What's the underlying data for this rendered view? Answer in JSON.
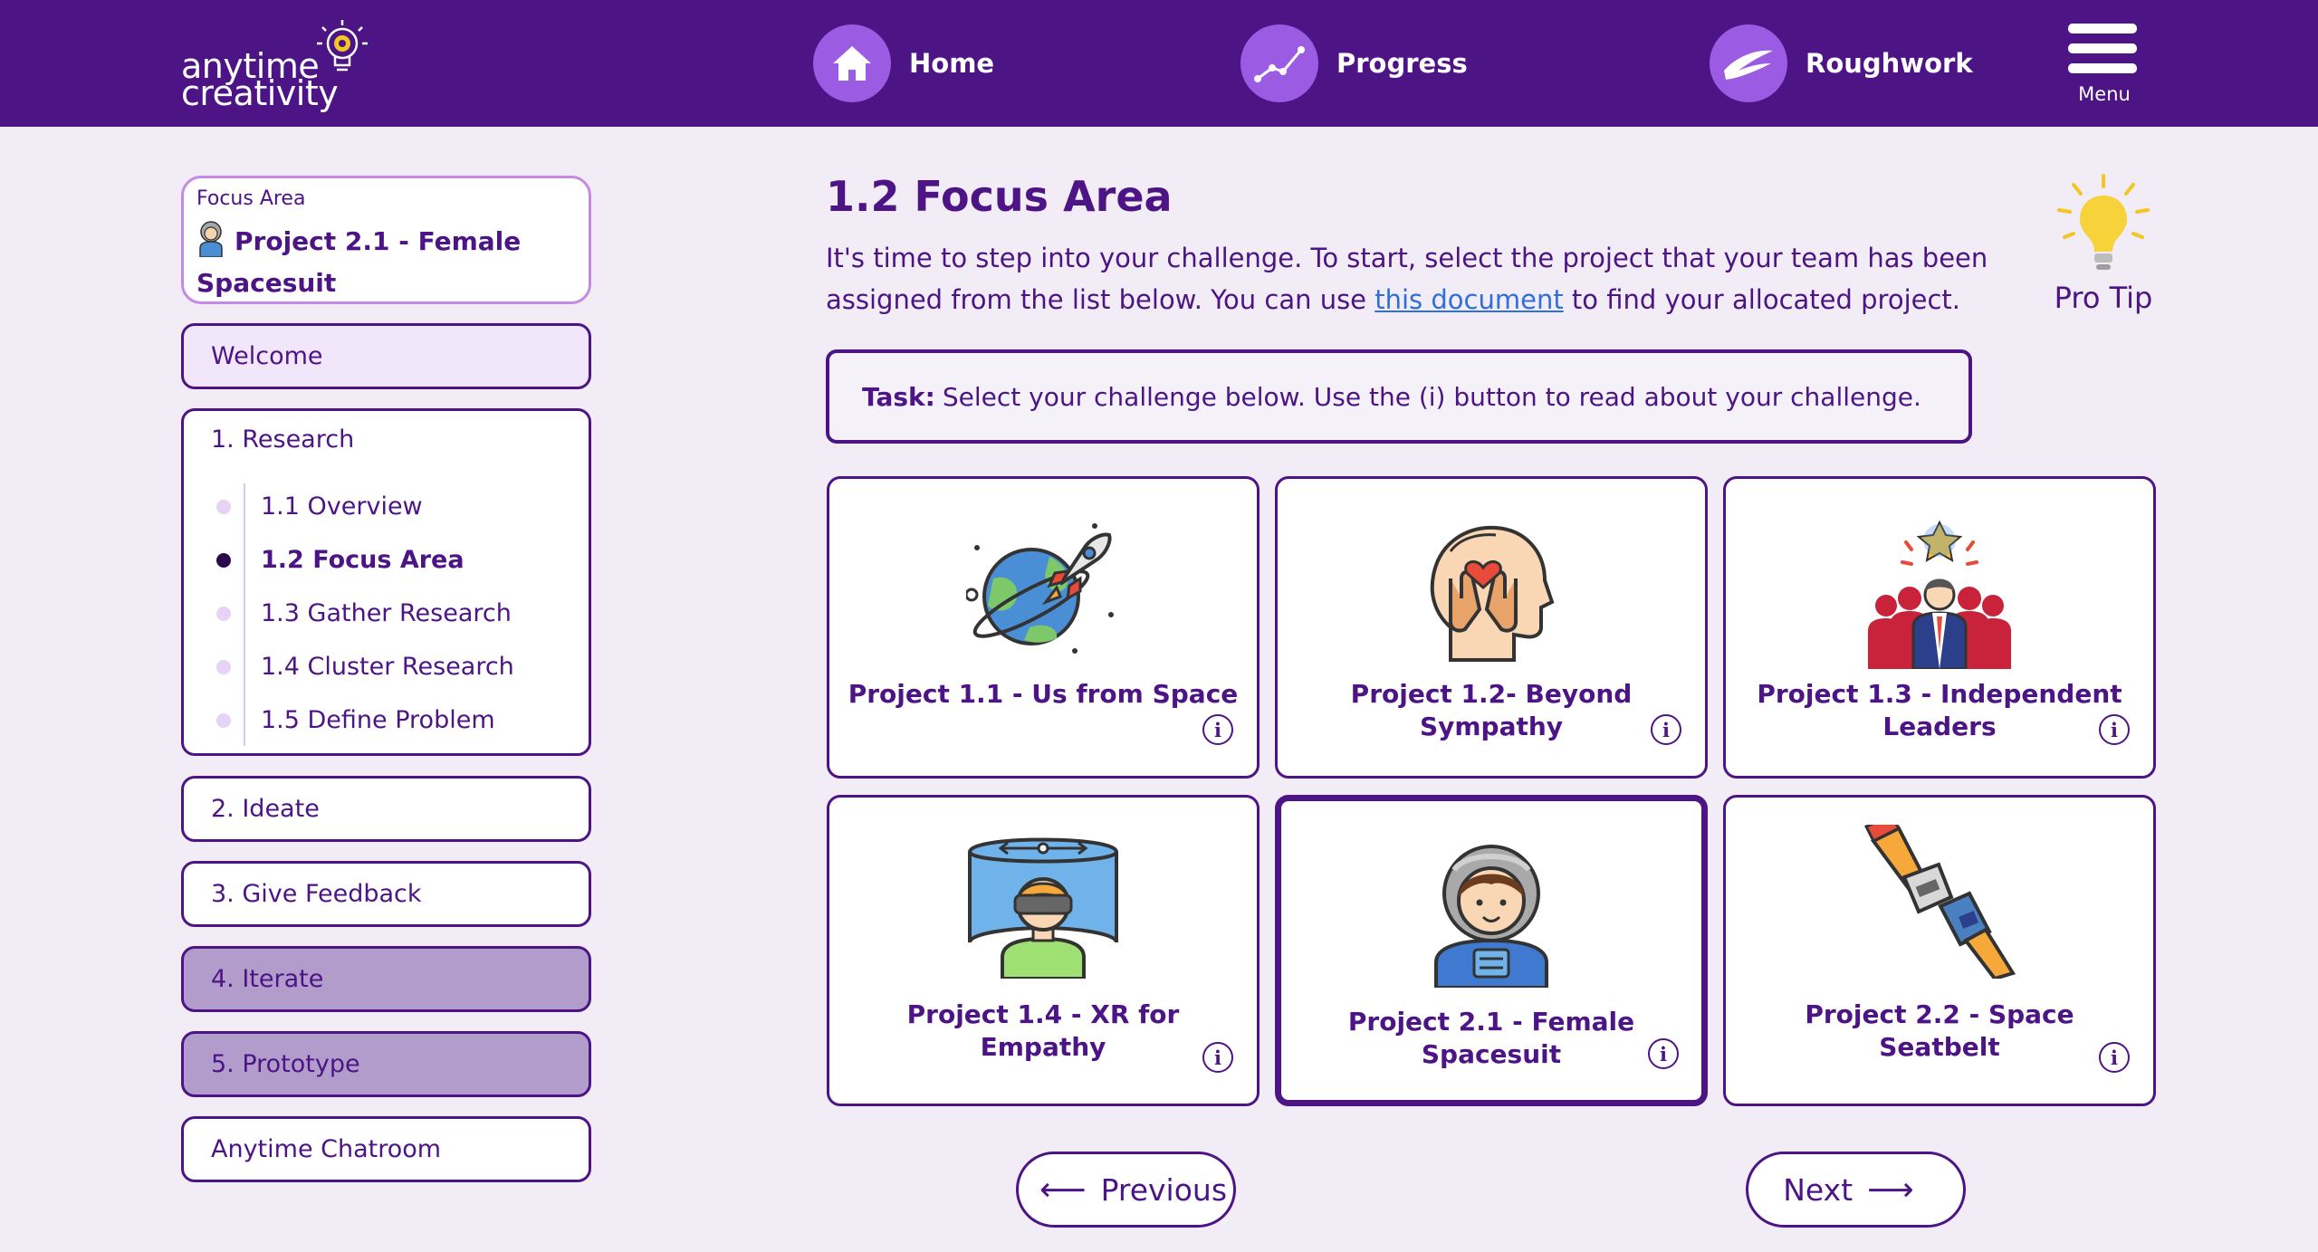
{
  "header": {
    "logo_line1": "anytime",
    "logo_line2": "creativity",
    "nav": [
      {
        "label": "Home",
        "icon": "home-icon"
      },
      {
        "label": "Progress",
        "icon": "progress-chart-icon"
      },
      {
        "label": "Roughwork",
        "icon": "brush-stroke-icon"
      }
    ],
    "menu_label": "Menu"
  },
  "sidebar": {
    "focus_caption": "Focus Area",
    "focus_value": "Project 2.1 - Female Spacesuit",
    "welcome": "Welcome",
    "research": {
      "label": "1. Research",
      "items": [
        {
          "label": "1.1 Overview",
          "active": false
        },
        {
          "label": "1.2 Focus Area",
          "active": true
        },
        {
          "label": "1.3 Gather Research",
          "active": false
        },
        {
          "label": "1.4 Cluster Research",
          "active": false
        },
        {
          "label": "1.5 Define Problem",
          "active": false
        }
      ]
    },
    "sections": [
      {
        "label": "2. Ideate",
        "locked": false
      },
      {
        "label": "3. Give Feedback",
        "locked": false
      },
      {
        "label": "4. Iterate",
        "locked": true
      },
      {
        "label": "5. Prototype",
        "locked": true
      },
      {
        "label": "Anytime Chatroom",
        "locked": false
      }
    ]
  },
  "main": {
    "title": "1.2 Focus Area",
    "intro_before_link": "It's time to step into your challenge. To start, select the project that your team has been assigned from the list below. You can use ",
    "intro_link": "this document",
    "intro_after_link": " to find your allocated project.",
    "protip_label": "Pro Tip",
    "task_label": "Task:",
    "task_text": "Select your challenge below. Use the (i) button to read about your challenge.",
    "info_glyph": "i",
    "projects": [
      {
        "title": "Project 1.1 - Us from Space",
        "icon": "planet-rocket-icon",
        "selected": false
      },
      {
        "title": "Project 1.2- Beyond Sympathy",
        "icon": "empathy-head-icon",
        "selected": false
      },
      {
        "title": "Project 1.3 - Independent Leaders",
        "icon": "leader-group-icon",
        "selected": false
      },
      {
        "title": "Project 1.4 - XR for Empathy",
        "icon": "vr-headset-icon",
        "selected": false
      },
      {
        "title": "Project 2.1 - Female Spacesuit",
        "icon": "female-astronaut-icon",
        "selected": true
      },
      {
        "title": "Project 2.2 - Space Seatbelt",
        "icon": "seatbelt-icon",
        "selected": false
      }
    ],
    "previous_label": "Previous",
    "next_label": "Next"
  },
  "colors": {
    "primary": "#4c1485",
    "accent": "#9b5be3",
    "background": "#f1ecf5",
    "locked": "#b19ccc",
    "link": "#2f6fd9"
  }
}
